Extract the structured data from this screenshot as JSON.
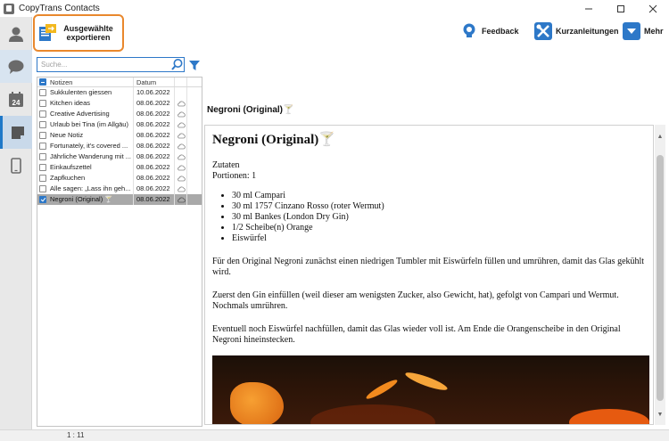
{
  "window": {
    "title": "CopyTrans Contacts"
  },
  "nav": {
    "items": [
      {
        "icon": "contacts-icon"
      },
      {
        "icon": "messages-icon"
      },
      {
        "icon": "calendar-icon",
        "day": "24"
      },
      {
        "icon": "notes-icon"
      },
      {
        "icon": "device-icon"
      }
    ]
  },
  "toolbar": {
    "export_label_line1": "Ausgewählte",
    "export_label_line2": "exportieren",
    "feedback_label": "Feedback",
    "guides_label": "Kurzanleitungen",
    "more_label": "Mehr"
  },
  "search": {
    "placeholder": "Suche..."
  },
  "list": {
    "headers": {
      "name": "Notizen",
      "date": "Datum"
    },
    "rows": [
      {
        "name": "Sukkulenten giessen",
        "date": "10.06.2022",
        "cloud": false,
        "selected": false
      },
      {
        "name": "Kitchen ideas",
        "date": "08.06.2022",
        "cloud": true,
        "selected": false
      },
      {
        "name": "Creative Advertising",
        "date": "08.06.2022",
        "cloud": true,
        "selected": false
      },
      {
        "name": "Urlaub bei Tina (im Allgäu)",
        "date": "08.06.2022",
        "cloud": true,
        "selected": false
      },
      {
        "name": "Neue Notiz",
        "date": "08.06.2022",
        "cloud": true,
        "selected": false
      },
      {
        "name": "Fortunately, it's covered ...",
        "date": "08.06.2022",
        "cloud": true,
        "selected": false
      },
      {
        "name": "Jährliche Wanderung mit ...",
        "date": "08.06.2022",
        "cloud": true,
        "selected": false
      },
      {
        "name": "Einkaufszettel",
        "date": "08.06.2022",
        "cloud": true,
        "selected": false
      },
      {
        "name": "Zapfkuchen",
        "date": "08.06.2022",
        "cloud": true,
        "selected": false
      },
      {
        "name": "Alle sagen: „Lass ihn geh...",
        "date": "08.06.2022",
        "cloud": true,
        "selected": false
      },
      {
        "name": "Negroni (Original) 🍸",
        "date": "08.06.2022",
        "cloud": true,
        "selected": true
      }
    ]
  },
  "detail": {
    "title": "Negroni (Original)🍸",
    "heading": "Negroni (Original)",
    "heading_emoji": "🍸",
    "zutaten": "Zutaten",
    "portionen": "Portionen: 1",
    "ingredients": [
      "30 ml Campari",
      "30 ml 1757 Cinzano Rosso (roter Wermut)",
      "30 ml Bankes (London Dry Gin)",
      "1/2 Scheibe(n) Orange",
      "Eiswürfel"
    ],
    "para1": "Für den Original Negroni zunächst einen niedrigen Tumbler mit Eiswürfeln füllen und umrühren, damit das Glas gekühlt wird.",
    "para2": "Zuerst den Gin einfüllen (weil dieser am wenigsten Zucker, also Gewicht, hat), gefolgt von Campari und Wermut. Nochmals umrühren.",
    "para3": "Eventuell noch Eiswürfel nachfüllen, damit das Glas wieder voll ist. Am Ende die Orangenscheibe in den Original Negroni hineinstecken."
  },
  "status": {
    "position": "1 : 11"
  },
  "colors": {
    "accent": "#2d78c8",
    "highlight": "#e9882d",
    "selected_row": "#a9a9a9"
  }
}
